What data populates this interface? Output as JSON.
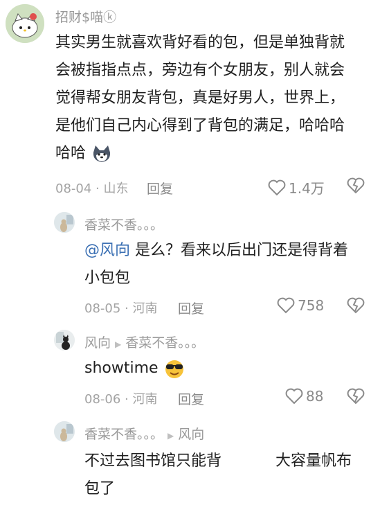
{
  "comments": [
    {
      "username": "招财$喵ⓚ",
      "lines": [
        "其实男生就喜欢背好看的包，但是单独背就",
        "会被指指点点，旁边有个女朋友，别人就会",
        "觉得帮女朋友背包，真是好男人，世界上，",
        "是他们自己内心得到了背包的满足，哈哈哈",
        "哈哈"
      ],
      "date": "08-04",
      "location": "山东",
      "reply_label": "回复",
      "likes": "1.4万"
    },
    {
      "username": "香菜不香。。。",
      "mention": "@风向",
      "line1_rest": " 是么？看来以后出门还是得背着",
      "line2": "小包包",
      "date": "08-05",
      "location": "河南",
      "reply_label": "回复",
      "likes": "758"
    },
    {
      "username": "风向",
      "reply_to": "香菜不香。。。",
      "text": "showtime",
      "date": "08-06",
      "location": "河南",
      "reply_label": "回复",
      "likes": "88"
    },
    {
      "username": "香菜不香。。。",
      "reply_to": "风向",
      "line1a": "不过去图书馆只能背",
      "line1b": "大容量帆布",
      "line2": "包了"
    }
  ],
  "separator": "·",
  "colors": {
    "meta_gray": "#a3a3a3",
    "mention_blue": "#3a6fb3",
    "text": "#1f1f1f"
  }
}
